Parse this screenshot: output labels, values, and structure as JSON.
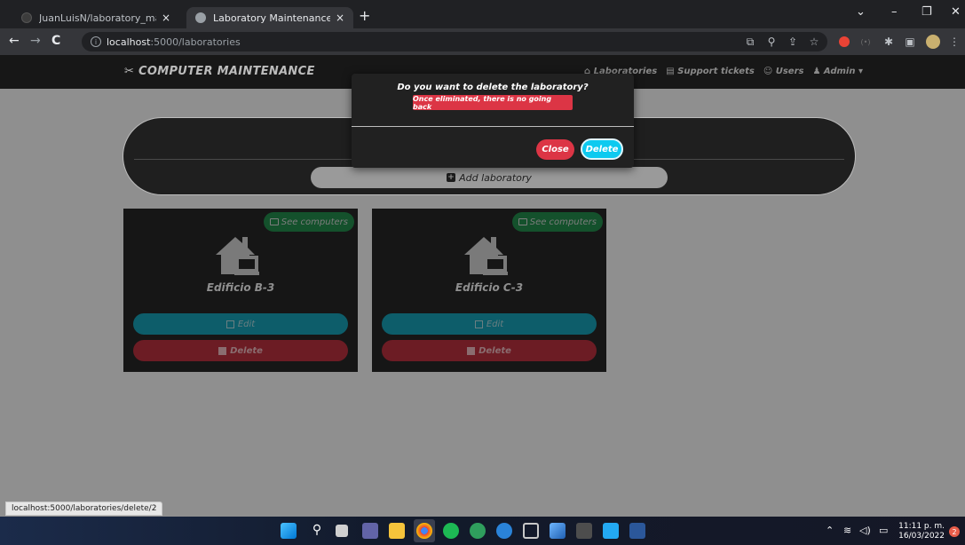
{
  "browser": {
    "tabs": [
      {
        "title": "JuanLuisN/laboratory_maintenan",
        "close": "×"
      },
      {
        "title": "Laboratory Maintenance",
        "close": "×"
      }
    ],
    "new_tab": "+",
    "window_controls": {
      "collapse": "⌄",
      "minimize": "–",
      "maximize": "❐",
      "close": "✕"
    },
    "nav": {
      "back": "←",
      "forward": "→",
      "reload": "C"
    },
    "url_host": "localhost",
    "url_path": ":5000/laboratories",
    "extensions": [
      "translate-icon",
      "zoom-icon",
      "share-icon",
      "star-icon",
      "extension-red-icon",
      "extension-dim-icon",
      "puzzle-icon",
      "sidepanel-icon",
      "profile-avatar"
    ]
  },
  "app": {
    "brand": "COMPUTER MAINTENANCE",
    "nav_links": [
      "Laboratories",
      "Support tickets",
      "Users",
      "Admin"
    ],
    "add_lab_label": "Add laboratory",
    "accent_colors": {
      "primary": "#0dcaf0",
      "danger": "#dc3545",
      "success": "#198754"
    }
  },
  "labs": [
    {
      "name": "Edificio B-3",
      "see_label": "See computers",
      "edit_label": "Edit",
      "delete_label": "Delete"
    },
    {
      "name": "Edificio C-3",
      "see_label": "See computers",
      "edit_label": "Edit",
      "delete_label": "Delete"
    }
  ],
  "modal": {
    "title": "Do you want to delete the laboratory?",
    "warning": "Once eliminated, there is no going back",
    "close_label": "Close",
    "delete_label": "Delete"
  },
  "status_url": "localhost:5000/laboratories/delete/2",
  "taskbar": {
    "apps": [
      "windows-start-icon",
      "search-icon",
      "task-view-icon",
      "teams-icon",
      "file-explorer-icon",
      "chrome-icon",
      "spotify-icon",
      "hs-app-icon",
      "app-blue-icon",
      "virtualbox-icon",
      "photos-icon",
      "terminal-icon",
      "vscode-icon",
      "word-icon"
    ],
    "time": "11:11 p. m.",
    "date": "16/03/2022",
    "notifications": "2"
  }
}
